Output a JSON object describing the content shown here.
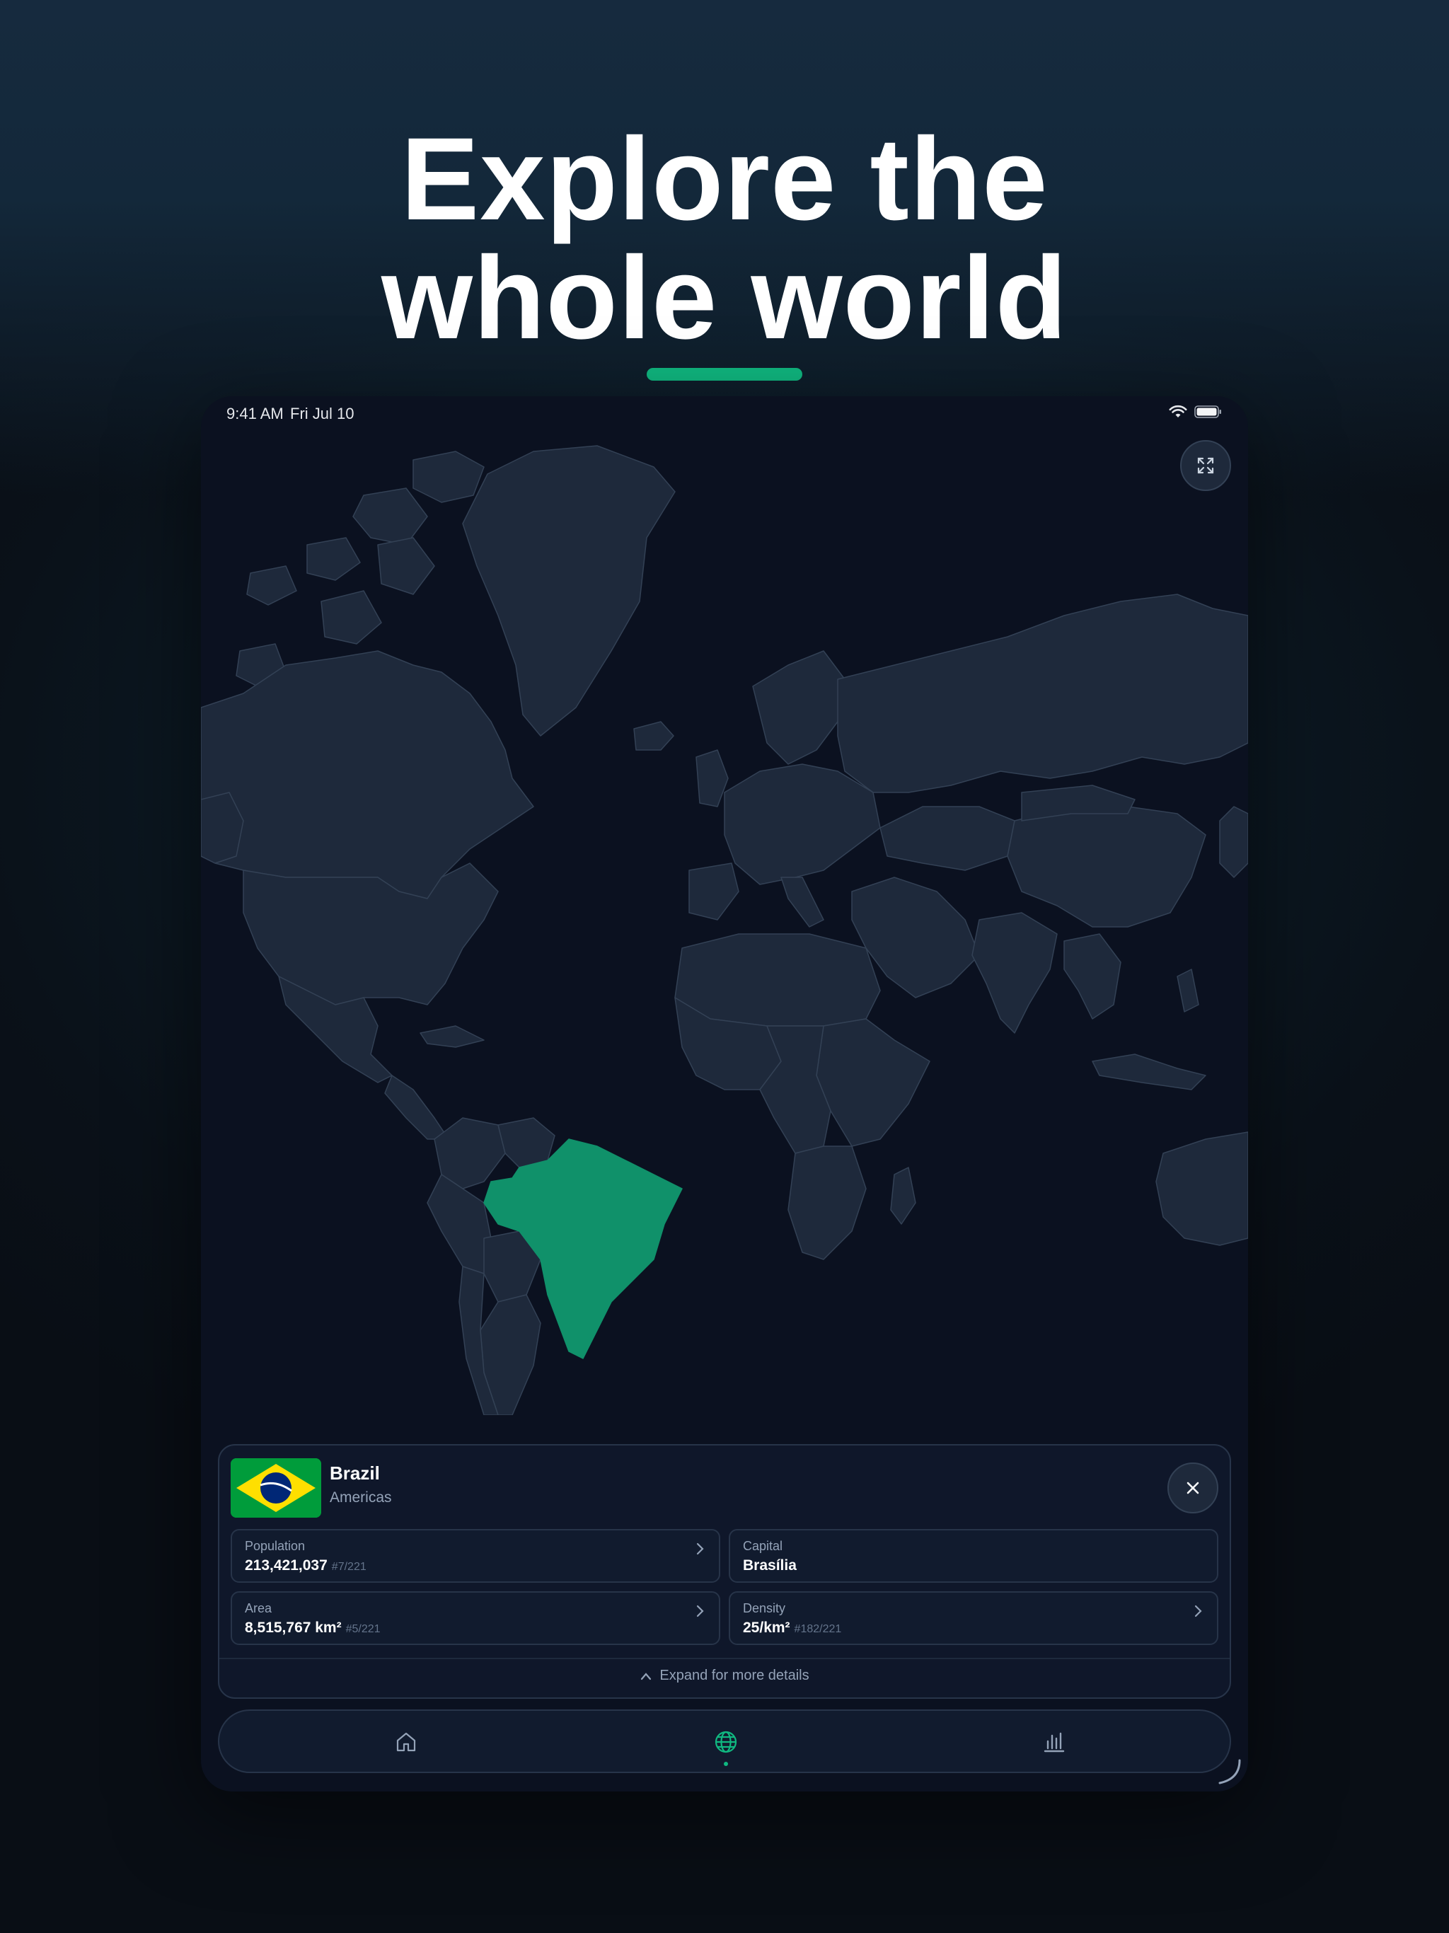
{
  "headline": {
    "line1": "Explore the",
    "line2": "whole world"
  },
  "colors": {
    "accent": "#10b981",
    "land": "#1e293b",
    "border": "#334155",
    "background": "#0b1120",
    "selected_country": "#10916a"
  },
  "status_bar": {
    "time": "9:41 AM",
    "date": "Fri Jul 10",
    "icons": [
      "wifi-icon",
      "battery-icon"
    ]
  },
  "map": {
    "selected_country": "Brazil",
    "expand_icon": "expand-icon"
  },
  "country_card": {
    "name": "Brazil",
    "region": "Americas",
    "stats": {
      "population": {
        "label": "Population",
        "value": "213,421,037",
        "rank": "#7/221"
      },
      "capital": {
        "label": "Capital",
        "value": "Brasília"
      },
      "area": {
        "label": "Area",
        "value": "8,515,767 km²",
        "rank": "#5/221"
      },
      "density": {
        "label": "Density",
        "value": "25/km²",
        "rank": "#182/221"
      }
    },
    "expand_label": "Expand for more details"
  },
  "tabbar": {
    "tabs": [
      {
        "name": "home",
        "icon": "home-icon",
        "active": false
      },
      {
        "name": "map",
        "icon": "globe-icon",
        "active": true
      },
      {
        "name": "stats",
        "icon": "bar-chart-icon",
        "active": false
      }
    ]
  }
}
